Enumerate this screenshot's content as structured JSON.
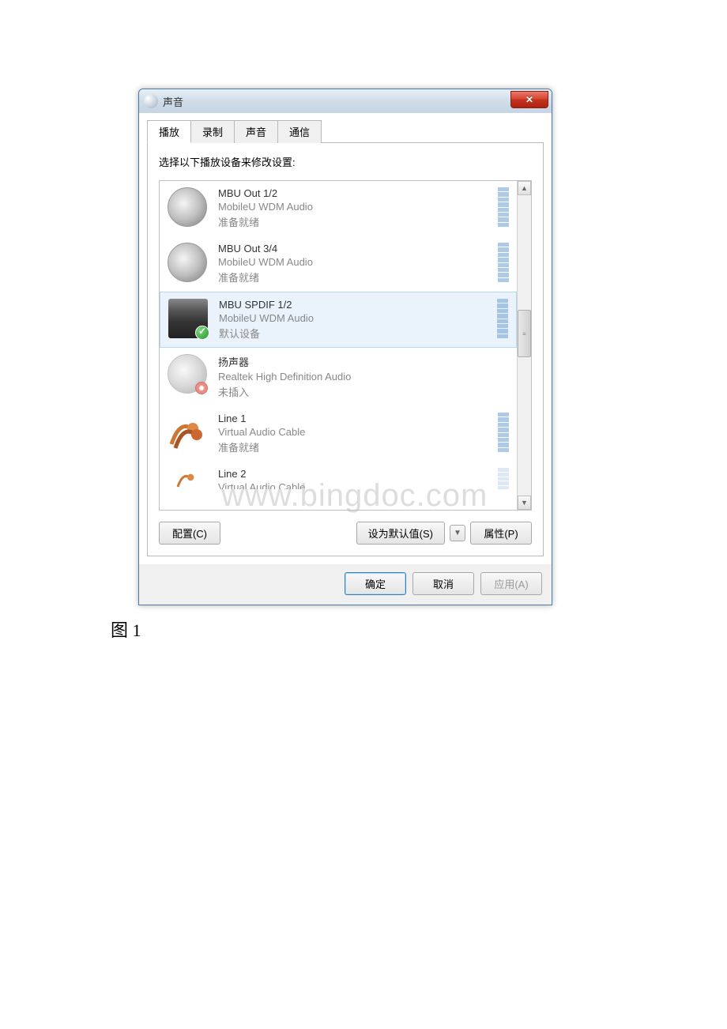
{
  "window": {
    "title": "声音"
  },
  "tabs": {
    "playback": "播放",
    "recording": "录制",
    "sounds": "声音",
    "communication": "通信"
  },
  "instruction": "选择以下播放设备来修改设置:",
  "devices": [
    {
      "name": "MBU Out 1/2",
      "driver": "MobileU WDM Audio",
      "status": "准备就绪",
      "icon": "speaker",
      "meter": true
    },
    {
      "name": "MBU Out 3/4",
      "driver": "MobileU WDM Audio",
      "status": "准备就绪",
      "icon": "speaker",
      "meter": true
    },
    {
      "name": "MBU SPDIF 1/2",
      "driver": "MobileU WDM Audio",
      "status": "默认设备",
      "icon": "spdif",
      "meter": true,
      "selected": true,
      "default": true
    },
    {
      "name": "扬声器",
      "driver": "Realtek High Definition Audio",
      "status": "未插入",
      "icon": "speaker",
      "meter": false,
      "unplugged": true
    },
    {
      "name": "Line 1",
      "driver": "Virtual Audio Cable",
      "status": "准备就绪",
      "icon": "cable",
      "meter": true
    },
    {
      "name": "Line 2",
      "driver": "Virtual Audio Cable",
      "status": "",
      "icon": "cable",
      "meter": true
    }
  ],
  "buttons": {
    "configure": "配置(C)",
    "set_default": "设为默认值(S)",
    "properties": "属性(P)",
    "ok": "确定",
    "cancel": "取消",
    "apply": "应用(A)"
  },
  "caption": "图 1",
  "watermark": "www.bingdoc.com"
}
